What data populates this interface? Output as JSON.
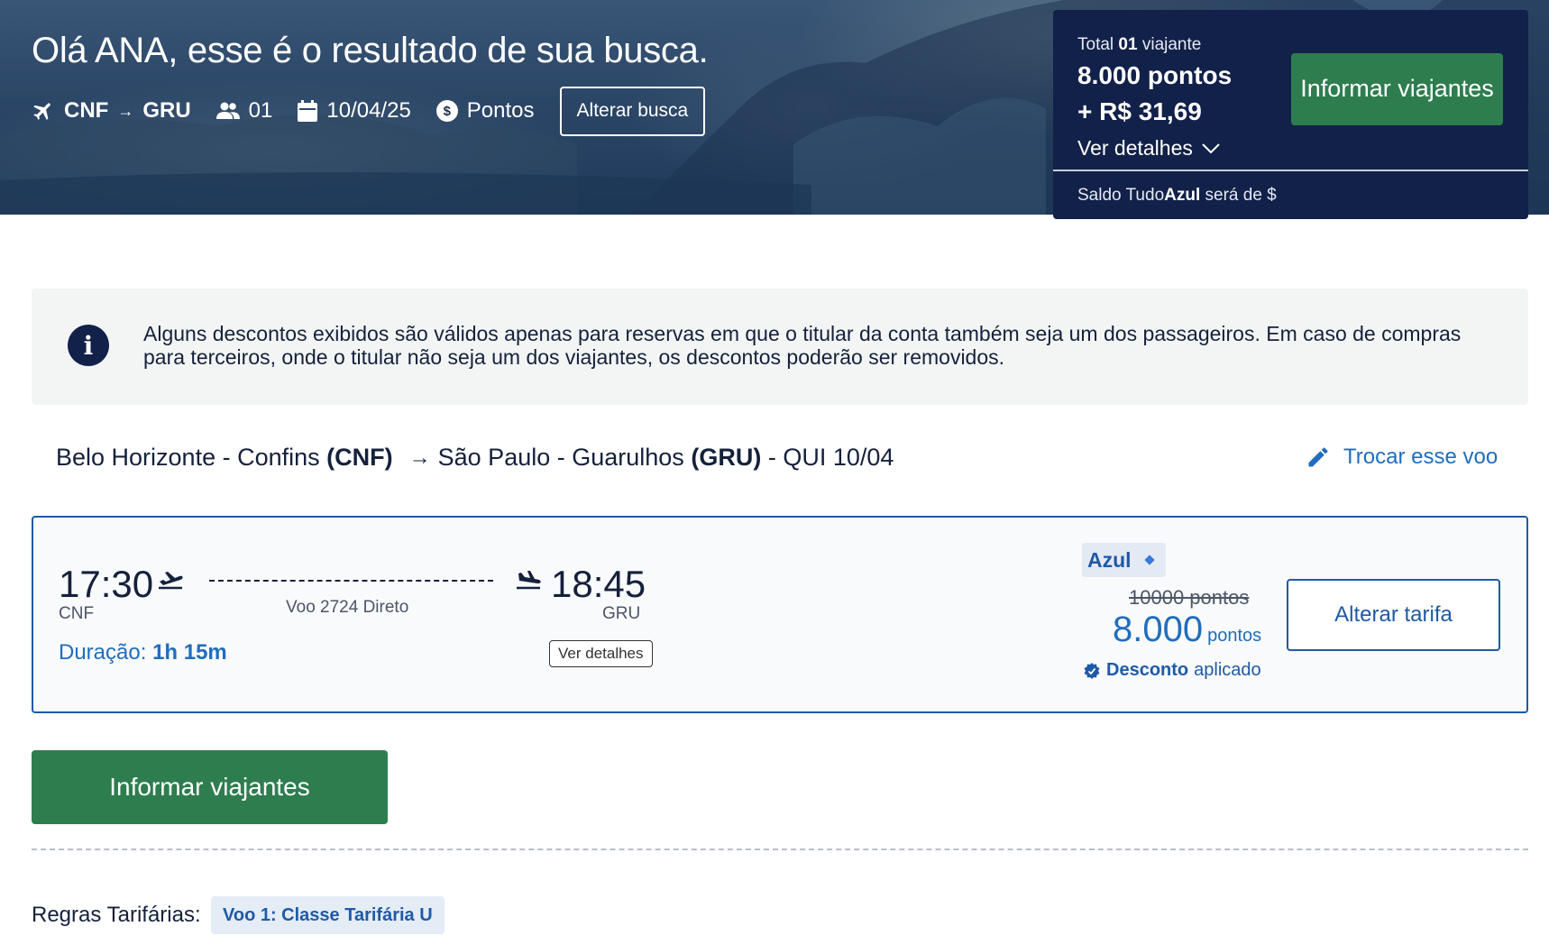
{
  "hero": {
    "greeting": "Olá ANA, esse é o resultado de sua busca.",
    "origin": "CNF",
    "destination": "GRU",
    "passengers": "01",
    "date": "10/04/25",
    "payment_mode": "Pontos",
    "change_search_label": "Alterar busca"
  },
  "summary": {
    "total_prefix": "Total",
    "traveler_count": "01",
    "traveler_label": "viajante",
    "points": "8.000 pontos",
    "money": "+ R$ 31,69",
    "details_label": "Ver detalhes",
    "cta_label": "Informar viajantes",
    "balance_prefix": "Saldo Tudo",
    "balance_brand": "Azul",
    "balance_suffix": "será de $"
  },
  "notice": {
    "text": "Alguns descontos exibidos são válidos apenas para reservas em que o titular da conta também seja um dos passageiros. Em caso de compras para terceiros, onde o titular não seja um dos viajantes, os descontos poderão ser removidos."
  },
  "route": {
    "origin_city": "Belo Horizonte - Confins",
    "origin_code": "(CNF)",
    "dest_city": "São Paulo - Guarulhos",
    "dest_code": "(GRU)",
    "date_suffix": "- QUI 10/04",
    "change_flight_label": "Trocar esse voo"
  },
  "flight": {
    "departure_time": "17:30",
    "departure_code": "CNF",
    "arrival_time": "18:45",
    "arrival_code": "GRU",
    "flight_info": "Voo 2724 Direto",
    "duration_label": "Duração:",
    "duration_value": "1h 15m",
    "details_label": "Ver detalhes",
    "fare_brand": "Azul",
    "old_price": "10000 pontos",
    "new_price_value": "8.000",
    "new_price_unit": "pontos",
    "discount_bold": "Desconto",
    "discount_rest": "aplicado",
    "change_fare_label": "Alterar tarifa"
  },
  "main_cta": {
    "label": "Informar viajantes"
  },
  "fare_rules": {
    "label": "Regras Tarifárias:",
    "chip_label": "Voo 1: Classe Tarifária U"
  },
  "colors": {
    "navy": "#122149",
    "green": "#2e7d4f",
    "blue": "#1f6ebd",
    "border_blue": "#1f5aa6"
  }
}
